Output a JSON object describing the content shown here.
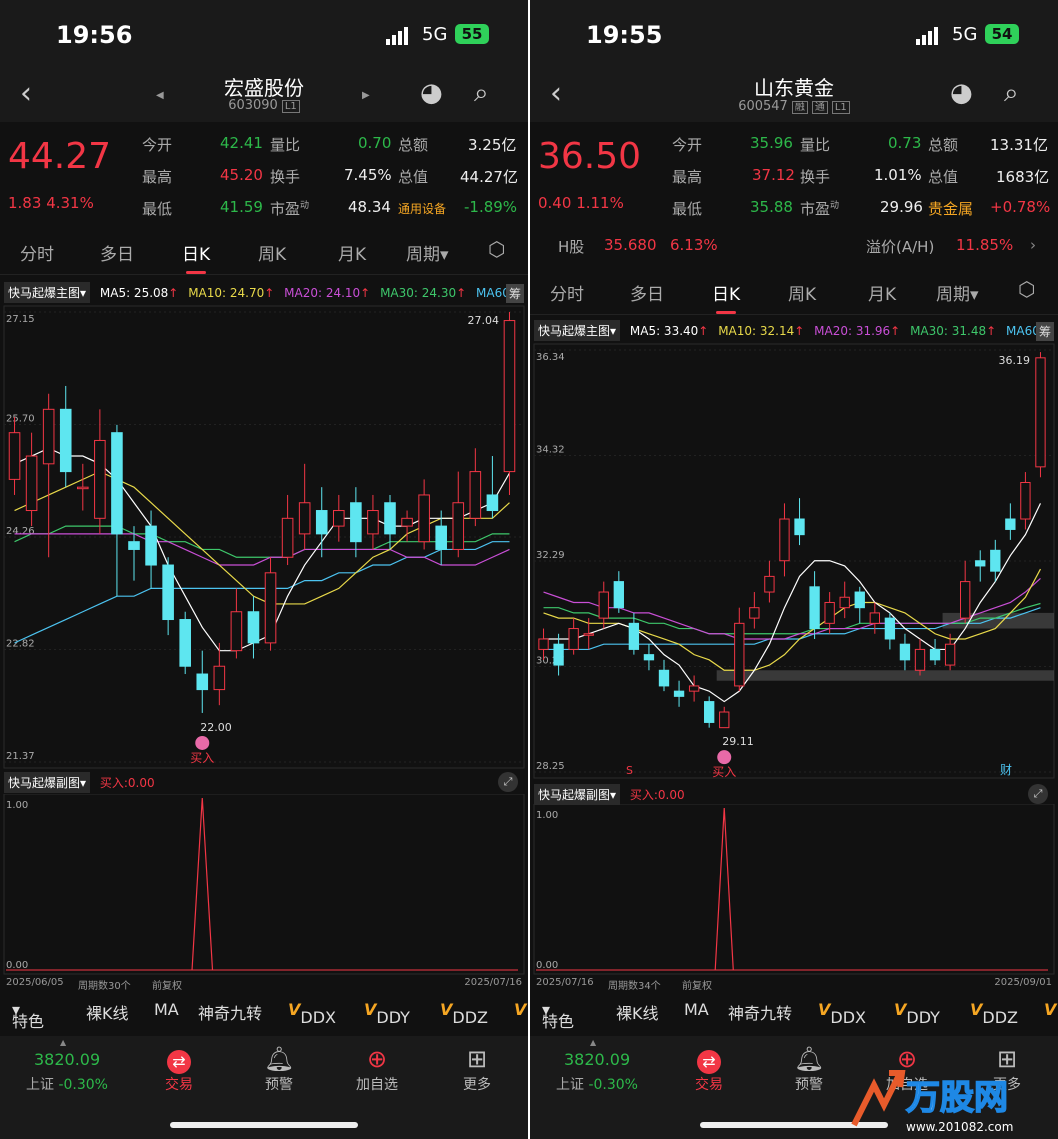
{
  "common": {
    "tabs": [
      "分时",
      "多日",
      "日K",
      "周K",
      "月K",
      "周期"
    ],
    "main_indicator": "快马起爆主图",
    "sub_indicator": "快马起爆副图",
    "sub_signal": "买入:0.00",
    "sub_y_top": "1.00",
    "sub_y_bottom": "0.00",
    "chou": "筹",
    "buy_label": "买入",
    "adjust": "前复权",
    "indicator_bar": [
      "特色",
      "裸K线",
      "MA",
      "神奇九转",
      "DDX",
      "DDY",
      "DDZ"
    ],
    "index_value": "3820.09",
    "index_name": "上证",
    "index_change": "-0.30%",
    "nav": [
      "交易",
      "预警",
      "加自选",
      "更多"
    ],
    "colors": {
      "up": "#f23645",
      "down": "#5ee6f0",
      "ma5": "#ffffff",
      "ma10": "#e8d94a",
      "ma20": "#c94fd6",
      "ma30": "#3ec76b",
      "ma60": "#4cc3f0"
    }
  },
  "left": {
    "time": "19:56",
    "network": "5G",
    "battery": "55",
    "name": "宏盛股份",
    "code": "603090",
    "tags": [
      "L1"
    ],
    "price": "44.27",
    "change": "1.83",
    "change_pct": "4.31%",
    "quote": {
      "open_label": "今开",
      "open": "42.41",
      "high_label": "最高",
      "high": "45.20",
      "low_label": "最低",
      "low": "41.59",
      "vr_label": "量比",
      "vr": "0.70",
      "turn_label": "换手",
      "turn": "7.45%",
      "pe_label": "市盈",
      "pe_sup": "动",
      "pe": "48.34",
      "amt_label": "总额",
      "amt": "3.25亿",
      "cap_label": "总值",
      "cap": "44.27亿",
      "sector": "通用设备",
      "sector_pct": "-1.89%"
    },
    "ma": {
      "ma5": "MA5: 25.08",
      "ma10": "MA10: 24.70",
      "ma20": "MA20: 24.10",
      "ma30": "MA30: 24.30",
      "ma60": "MA60:"
    },
    "y_ticks": [
      "27.15",
      "25.70",
      "24.26",
      "22.82",
      "21.37"
    ],
    "max_label": "27.04",
    "min_label": "22.00",
    "date_start": "2025/06/05",
    "period_count": "周期数30个",
    "date_end": "2025/07/16"
  },
  "right": {
    "time": "19:55",
    "network": "5G",
    "battery": "54",
    "name": "山东黄金",
    "code": "600547",
    "tags": [
      "融",
      "通",
      "L1"
    ],
    "price": "36.50",
    "change": "0.40",
    "change_pct": "1.11%",
    "quote": {
      "open_label": "今开",
      "open": "35.96",
      "high_label": "最高",
      "high": "37.12",
      "low_label": "最低",
      "low": "35.88",
      "vr_label": "量比",
      "vr": "0.73",
      "turn_label": "换手",
      "turn": "1.01%",
      "pe_label": "市盈",
      "pe_sup": "动",
      "pe": "29.96",
      "amt_label": "总额",
      "amt": "13.31亿",
      "cap_label": "总值",
      "cap": "1683亿",
      "sector": "贵金属",
      "sector_pct": "+0.78%"
    },
    "h_label": "H股",
    "h_price": "35.680",
    "h_pct": "6.13%",
    "premium_label": "溢价(A/H)",
    "premium": "11.85%",
    "ma": {
      "ma5": "MA5: 33.40",
      "ma10": "MA10: 32.14",
      "ma20": "MA20: 31.96",
      "ma30": "MA30: 31.48",
      "ma60": "MA60:"
    },
    "y_ticks": [
      "36.34",
      "34.32",
      "32.29",
      "30.27",
      "28.25"
    ],
    "max_label": "36.19",
    "min_label": "29.11",
    "s_marker": "S",
    "cai_marker": "财",
    "date_start": "2025/07/16",
    "period_count": "周期数34个",
    "date_end": "2025/09/01"
  },
  "chart_data": [
    {
      "type": "candlestick",
      "series_name": "宏盛股份 日K",
      "ylim": [
        21.37,
        27.15
      ],
      "candles": [
        {
          "o": 25.0,
          "c": 25.6,
          "h": 25.8,
          "l": 24.8
        },
        {
          "o": 24.6,
          "c": 25.3,
          "h": 25.6,
          "l": 24.4
        },
        {
          "o": 25.2,
          "c": 25.9,
          "h": 26.1,
          "l": 24.0
        },
        {
          "o": 25.9,
          "c": 25.1,
          "h": 26.2,
          "l": 24.9
        },
        {
          "o": 24.9,
          "c": 24.9,
          "h": 25.2,
          "l": 24.6
        },
        {
          "o": 24.5,
          "c": 25.5,
          "h": 25.9,
          "l": 24.3
        },
        {
          "o": 25.6,
          "c": 24.3,
          "h": 25.7,
          "l": 23.5
        },
        {
          "o": 24.2,
          "c": 24.1,
          "h": 24.4,
          "l": 23.7
        },
        {
          "o": 24.4,
          "c": 23.9,
          "h": 24.6,
          "l": 23.6
        },
        {
          "o": 23.9,
          "c": 23.2,
          "h": 24.0,
          "l": 23.0
        },
        {
          "o": 23.2,
          "c": 22.6,
          "h": 23.3,
          "l": 22.5
        },
        {
          "o": 22.5,
          "c": 22.3,
          "h": 22.8,
          "l": 22.0
        },
        {
          "o": 22.3,
          "c": 22.6,
          "h": 22.9,
          "l": 22.1
        },
        {
          "o": 22.8,
          "c": 23.3,
          "h": 23.6,
          "l": 22.7
        },
        {
          "o": 23.3,
          "c": 22.9,
          "h": 23.5,
          "l": 22.7
        },
        {
          "o": 22.9,
          "c": 23.8,
          "h": 24.0,
          "l": 22.8
        },
        {
          "o": 24.0,
          "c": 24.5,
          "h": 24.8,
          "l": 23.9
        },
        {
          "o": 24.3,
          "c": 24.7,
          "h": 25.2,
          "l": 24.1
        },
        {
          "o": 24.6,
          "c": 24.3,
          "h": 24.9,
          "l": 24.0
        },
        {
          "o": 24.4,
          "c": 24.6,
          "h": 24.8,
          "l": 24.2
        },
        {
          "o": 24.7,
          "c": 24.2,
          "h": 24.9,
          "l": 24.0
        },
        {
          "o": 24.3,
          "c": 24.6,
          "h": 24.8,
          "l": 24.1
        },
        {
          "o": 24.7,
          "c": 24.3,
          "h": 24.8,
          "l": 24.1
        },
        {
          "o": 24.4,
          "c": 24.5,
          "h": 24.6,
          "l": 24.2
        },
        {
          "o": 24.2,
          "c": 24.8,
          "h": 25.0,
          "l": 24.1
        },
        {
          "o": 24.4,
          "c": 24.1,
          "h": 24.6,
          "l": 23.9
        },
        {
          "o": 24.1,
          "c": 24.7,
          "h": 25.1,
          "l": 24.0
        },
        {
          "o": 24.5,
          "c": 25.1,
          "h": 25.4,
          "l": 24.4
        },
        {
          "o": 24.8,
          "c": 24.6,
          "h": 25.3,
          "l": 24.5
        },
        {
          "o": 25.1,
          "c": 27.04,
          "h": 27.15,
          "l": 24.8
        }
      ],
      "ma5": [
        25.2,
        25.3,
        25.4,
        25.3,
        25.3,
        25.2,
        25.0,
        24.7,
        24.4,
        23.9,
        23.5,
        23.1,
        22.8,
        22.8,
        22.9,
        23.0,
        23.5,
        23.9,
        24.2,
        24.5,
        24.5,
        24.5,
        24.4,
        24.4,
        24.5,
        24.5,
        24.5,
        24.6,
        24.7,
        25.08
      ],
      "ma10": [
        24.6,
        24.7,
        24.8,
        24.9,
        25.0,
        25.1,
        25.0,
        24.9,
        24.7,
        24.5,
        24.3,
        24.1,
        23.9,
        23.7,
        23.5,
        23.4,
        23.4,
        23.4,
        23.5,
        23.6,
        23.8,
        24.0,
        24.1,
        24.3,
        24.4,
        24.5,
        24.5,
        24.5,
        24.5,
        24.7
      ],
      "ma20": [
        24.3,
        24.3,
        24.3,
        24.3,
        24.3,
        24.3,
        24.3,
        24.3,
        24.2,
        24.2,
        24.1,
        24.0,
        23.9,
        23.9,
        23.9,
        24.0,
        24.0,
        24.1,
        24.1,
        24.1,
        24.1,
        24.1,
        24.1,
        24.0,
        24.0,
        23.9,
        23.9,
        23.9,
        24.0,
        24.1
      ],
      "ma30": [
        24.2,
        24.3,
        24.3,
        24.4,
        24.4,
        24.4,
        24.4,
        24.3,
        24.3,
        24.2,
        24.2,
        24.1,
        24.1,
        24.0,
        24.0,
        24.0,
        24.0,
        24.1,
        24.1,
        24.1,
        24.1,
        24.1,
        24.2,
        24.2,
        24.2,
        24.2,
        24.2,
        24.2,
        24.3,
        24.3
      ],
      "ma60": [
        22.9,
        23.0,
        23.1,
        23.2,
        23.3,
        23.4,
        23.5,
        23.5,
        23.6,
        23.6,
        23.6,
        23.6,
        23.6,
        23.6,
        23.6,
        23.6,
        23.6,
        23.7,
        23.7,
        23.8,
        23.8,
        23.9,
        23.9,
        24.0,
        24.0,
        24.1,
        24.1,
        24.1,
        24.2,
        24.2
      ],
      "buy_signal_index": 11,
      "sub_signal": [
        0,
        0,
        0,
        0,
        0,
        0,
        0,
        0,
        0,
        0,
        0,
        1,
        0,
        0,
        0,
        0,
        0,
        0,
        0,
        0,
        0,
        0,
        0,
        0,
        0,
        0,
        0,
        0,
        0,
        0
      ]
    },
    {
      "type": "candlestick",
      "series_name": "山东黄金 日K",
      "ylim": [
        28.25,
        36.34
      ],
      "candles": [
        {
          "o": 30.6,
          "c": 30.8,
          "h": 31.0,
          "l": 30.4
        },
        {
          "o": 30.7,
          "c": 30.3,
          "h": 30.9,
          "l": 30.1
        },
        {
          "o": 30.6,
          "c": 31.0,
          "h": 31.2,
          "l": 30.5
        },
        {
          "o": 30.9,
          "c": 30.9,
          "h": 31.2,
          "l": 30.6
        },
        {
          "o": 31.2,
          "c": 31.7,
          "h": 31.9,
          "l": 31.0
        },
        {
          "o": 31.9,
          "c": 31.4,
          "h": 32.1,
          "l": 31.3
        },
        {
          "o": 31.1,
          "c": 30.6,
          "h": 31.3,
          "l": 30.5
        },
        {
          "o": 30.5,
          "c": 30.4,
          "h": 30.7,
          "l": 30.2
        },
        {
          "o": 30.2,
          "c": 29.9,
          "h": 30.4,
          "l": 29.8
        },
        {
          "o": 29.8,
          "c": 29.7,
          "h": 30.0,
          "l": 29.5
        },
        {
          "o": 29.8,
          "c": 29.9,
          "h": 30.1,
          "l": 29.6
        },
        {
          "o": 29.6,
          "c": 29.2,
          "h": 29.7,
          "l": 29.1
        },
        {
          "o": 29.1,
          "c": 29.4,
          "h": 29.5,
          "l": 29.11
        },
        {
          "o": 29.9,
          "c": 31.1,
          "h": 31.4,
          "l": 29.8
        },
        {
          "o": 31.2,
          "c": 31.4,
          "h": 31.7,
          "l": 31.0
        },
        {
          "o": 31.7,
          "c": 32.0,
          "h": 32.3,
          "l": 31.5
        },
        {
          "o": 32.3,
          "c": 33.1,
          "h": 33.4,
          "l": 32.0
        },
        {
          "o": 33.1,
          "c": 32.8,
          "h": 33.5,
          "l": 32.6
        },
        {
          "o": 31.8,
          "c": 31.0,
          "h": 32.1,
          "l": 30.8
        },
        {
          "o": 31.1,
          "c": 31.5,
          "h": 31.7,
          "l": 30.9
        },
        {
          "o": 31.4,
          "c": 31.6,
          "h": 31.9,
          "l": 31.2
        },
        {
          "o": 31.7,
          "c": 31.4,
          "h": 31.8,
          "l": 31.1
        },
        {
          "o": 31.1,
          "c": 31.3,
          "h": 31.5,
          "l": 30.9
        },
        {
          "o": 31.2,
          "c": 30.8,
          "h": 31.3,
          "l": 30.6
        },
        {
          "o": 30.7,
          "c": 30.4,
          "h": 30.9,
          "l": 30.2
        },
        {
          "o": 30.2,
          "c": 30.6,
          "h": 30.8,
          "l": 30.1
        },
        {
          "o": 30.6,
          "c": 30.4,
          "h": 30.8,
          "l": 30.3
        },
        {
          "o": 30.3,
          "c": 30.7,
          "h": 30.9,
          "l": 30.2
        },
        {
          "o": 31.2,
          "c": 31.9,
          "h": 32.3,
          "l": 31.1
        },
        {
          "o": 32.3,
          "c": 32.2,
          "h": 32.5,
          "l": 31.9
        },
        {
          "o": 32.5,
          "c": 32.1,
          "h": 32.7,
          "l": 31.9
        },
        {
          "o": 33.1,
          "c": 32.9,
          "h": 33.4,
          "l": 32.7
        },
        {
          "o": 33.1,
          "c": 33.8,
          "h": 34.0,
          "l": 32.9
        },
        {
          "o": 34.1,
          "c": 36.19,
          "h": 36.3,
          "l": 33.9
        }
      ],
      "ma5": [
        30.8,
        30.8,
        30.8,
        30.9,
        31.0,
        31.1,
        31.0,
        30.8,
        30.5,
        30.3,
        29.9,
        29.8,
        29.6,
        29.8,
        30.2,
        30.7,
        31.4,
        32.0,
        32.3,
        32.3,
        32.2,
        31.9,
        31.5,
        31.3,
        31.0,
        30.8,
        30.6,
        30.6,
        31.0,
        31.5,
        31.9,
        32.4,
        32.8,
        33.4
      ],
      "ma10": [
        31.3,
        31.2,
        31.2,
        31.1,
        31.1,
        31.1,
        31.0,
        30.9,
        30.8,
        30.7,
        30.5,
        30.4,
        30.2,
        30.2,
        30.2,
        30.3,
        30.5,
        30.8,
        31.0,
        31.2,
        31.4,
        31.5,
        31.5,
        31.4,
        31.3,
        31.1,
        30.9,
        30.8,
        30.8,
        30.9,
        31.0,
        31.3,
        31.6,
        32.14
      ],
      "ma20": [
        31.7,
        31.6,
        31.5,
        31.5,
        31.4,
        31.4,
        31.3,
        31.3,
        31.2,
        31.1,
        31.0,
        30.9,
        30.9,
        30.8,
        30.8,
        30.8,
        30.8,
        30.9,
        30.9,
        31.0,
        31.0,
        31.0,
        31.1,
        31.1,
        31.1,
        31.1,
        31.1,
        31.1,
        31.2,
        31.3,
        31.4,
        31.5,
        31.7,
        31.96
      ],
      "ma30": [
        31.4,
        31.4,
        31.3,
        31.3,
        31.2,
        31.2,
        31.2,
        31.1,
        31.1,
        31.0,
        31.0,
        30.9,
        30.9,
        30.9,
        30.9,
        30.9,
        30.9,
        30.9,
        31.0,
        31.0,
        31.0,
        31.1,
        31.1,
        31.1,
        31.1,
        31.1,
        31.1,
        31.1,
        31.1,
        31.2,
        31.2,
        31.3,
        31.4,
        31.48
      ],
      "ma60": [
        30.6,
        30.6,
        30.6,
        30.6,
        30.7,
        30.7,
        30.7,
        30.7,
        30.7,
        30.7,
        30.7,
        30.7,
        30.7,
        30.7,
        30.7,
        30.8,
        30.8,
        30.8,
        30.9,
        30.9,
        30.9,
        31.0,
        31.0,
        31.0,
        31.0,
        31.0,
        31.0,
        31.1,
        31.1,
        31.1,
        31.2,
        31.2,
        31.3,
        31.4
      ],
      "buy_signal_index": 12,
      "sub_signal": [
        0,
        0,
        0,
        0,
        0,
        0,
        0,
        0,
        0,
        0,
        0,
        0,
        1,
        0,
        0,
        0,
        0,
        0,
        0,
        0,
        0,
        0,
        0,
        0,
        0,
        0,
        0,
        0,
        0,
        0,
        0,
        0,
        0,
        0
      ]
    }
  ]
}
